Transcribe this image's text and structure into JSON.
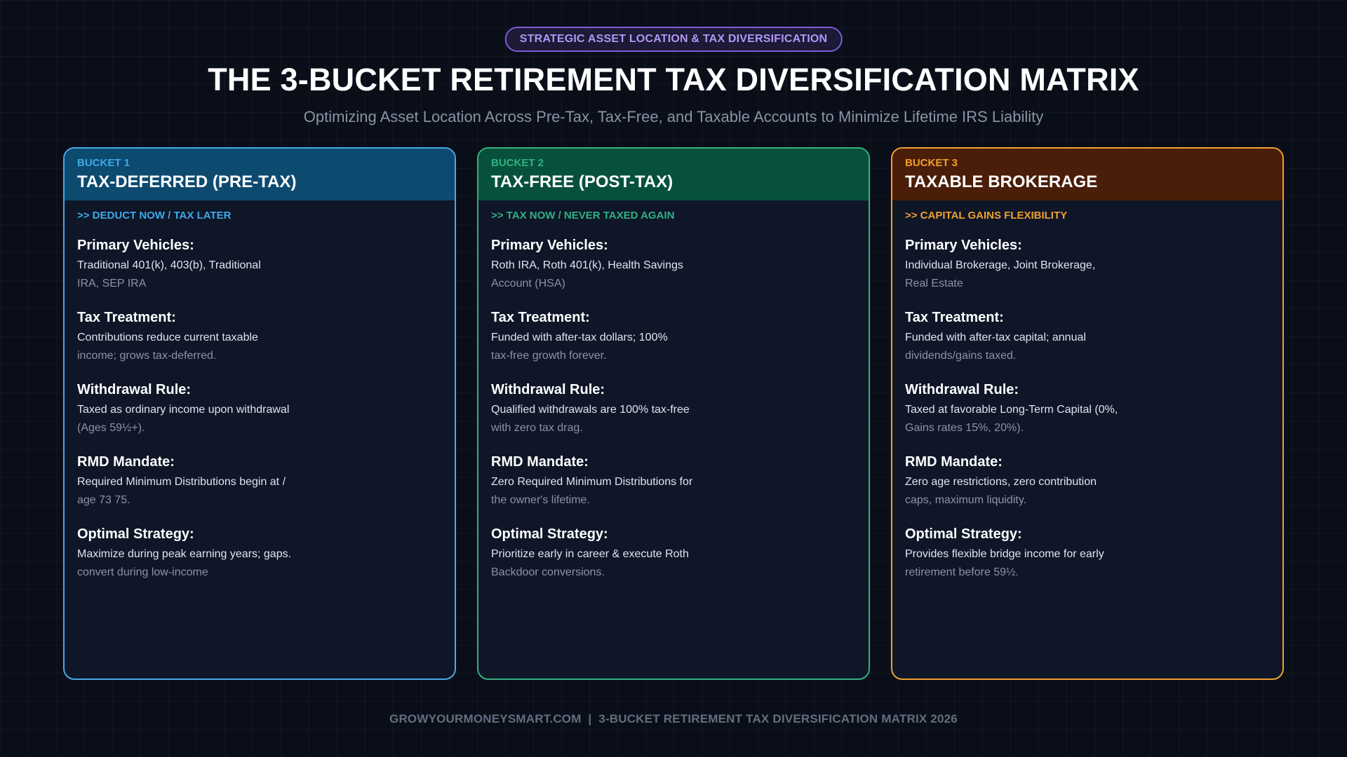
{
  "badge": "STRATEGIC ASSET LOCATION & TAX DIVERSIFICATION",
  "title": "THE 3-BUCKET RETIREMENT TAX DIVERSIFICATION MATRIX",
  "subtitle": "Optimizing Asset Location Across Pre-Tax, Tax-Free, and Taxable Accounts to Minimize Lifetime IRS Liability",
  "colors": {
    "bucket1": "#3fa9e8",
    "bucket2": "#2fb283",
    "bucket3": "#f0a02e",
    "badge": "#7c5cd6"
  },
  "buckets": [
    {
      "number": "BUCKET 1",
      "name": "TAX-DEFERRED (PRE-TAX)",
      "tagline": ">> DEDUCT NOW / TAX LATER",
      "sections": [
        {
          "label": "Primary Vehicles:",
          "line1": "Traditional 401(k), 403(b), Traditional",
          "line2": "IRA, SEP IRA"
        },
        {
          "label": "Tax Treatment:",
          "line1": "Contributions reduce current taxable",
          "line2": "income; grows tax-deferred."
        },
        {
          "label": "Withdrawal Rule:",
          "line1": "Taxed as ordinary income upon withdrawal",
          "line2": "(Ages 59½+)."
        },
        {
          "label": "RMD Mandate:",
          "line1": "Required Minimum Distributions begin at /",
          "line2": "age 73 75."
        },
        {
          "label": "Optimal Strategy:",
          "line1": "Maximize during peak earning years; gaps.",
          "line2": "convert during low-income"
        }
      ]
    },
    {
      "number": "BUCKET 2",
      "name": "TAX-FREE (POST-TAX)",
      "tagline": ">> TAX NOW / NEVER TAXED AGAIN",
      "sections": [
        {
          "label": "Primary Vehicles:",
          "line1": "Roth IRA, Roth 401(k), Health Savings",
          "line2": "Account (HSA)"
        },
        {
          "label": "Tax Treatment:",
          "line1": "Funded with after-tax dollars; 100%",
          "line2": "tax-free growth forever."
        },
        {
          "label": "Withdrawal Rule:",
          "line1": "Qualified withdrawals are 100% tax-free",
          "line2": "with zero tax drag."
        },
        {
          "label": "RMD Mandate:",
          "line1": "Zero Required Minimum Distributions for",
          "line2": "the owner's lifetime."
        },
        {
          "label": "Optimal Strategy:",
          "line1": "Prioritize early in career & execute Roth",
          "line2": "Backdoor conversions."
        }
      ]
    },
    {
      "number": "BUCKET 3",
      "name": "TAXABLE BROKERAGE",
      "tagline": ">> CAPITAL GAINS FLEXIBILITY",
      "sections": [
        {
          "label": "Primary Vehicles:",
          "line1": "Individual Brokerage, Joint Brokerage,",
          "line2": "Real Estate"
        },
        {
          "label": "Tax Treatment:",
          "line1": "Funded with after-tax capital; annual",
          "line2": "dividends/gains taxed."
        },
        {
          "label": "Withdrawal Rule:",
          "line1": "Taxed at favorable Long-Term Capital (0%,",
          "line2": "Gains rates 15%, 20%)."
        },
        {
          "label": "RMD Mandate:",
          "line1": "Zero age restrictions, zero contribution",
          "line2": "caps, maximum liquidity."
        },
        {
          "label": "Optimal Strategy:",
          "line1": "Provides flexible bridge income for early",
          "line2": "retirement before 59½."
        }
      ]
    }
  ],
  "footer": "GROWYOURMONEYSMART.COM  |  3-BUCKET RETIREMENT TAX DIVERSIFICATION MATRIX 2026"
}
